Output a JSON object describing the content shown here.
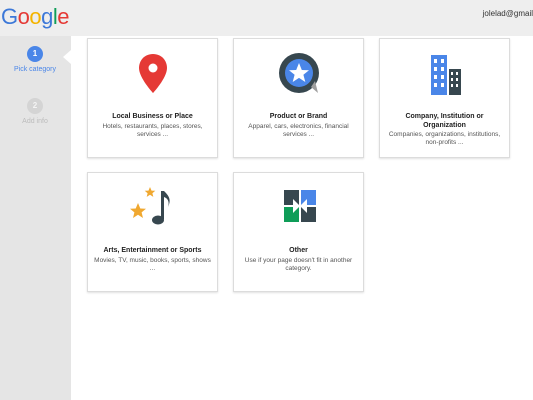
{
  "header": {
    "logo_letters": [
      "G",
      "o",
      "o",
      "g",
      "l",
      "e"
    ],
    "logo_colors": [
      "#3c78d8",
      "#e53935",
      "#f4b400",
      "#3c78d8",
      "#0f9d58",
      "#e53935"
    ],
    "account": "jolelad@gmail"
  },
  "steps": [
    {
      "number": "1",
      "label": "Pick category"
    },
    {
      "number": "2",
      "label": "Add info"
    }
  ],
  "categories": [
    {
      "title": "Local Business or Place",
      "description": "Hotels, restaurants, places, stores, services ...",
      "icon": "map-pin-icon"
    },
    {
      "title": "Product or Brand",
      "description": "Apparel, cars, electronics, financial services ...",
      "icon": "star-badge-icon"
    },
    {
      "title": "Company, Institution or Organization",
      "description": "Companies, organizations, institutions, non-profits ...",
      "icon": "buildings-icon"
    },
    {
      "title": "Arts, Entertainment or Sports",
      "description": "Movies, TV, music, books, sports, shows ...",
      "icon": "music-stars-icon"
    },
    {
      "title": "Other",
      "description": "Use if your page doesn't fit in another category.",
      "icon": "squares-arrows-icon"
    }
  ],
  "colors": {
    "accent": "#4a86e8",
    "pin": "#e53935",
    "star": "#f0a830"
  }
}
